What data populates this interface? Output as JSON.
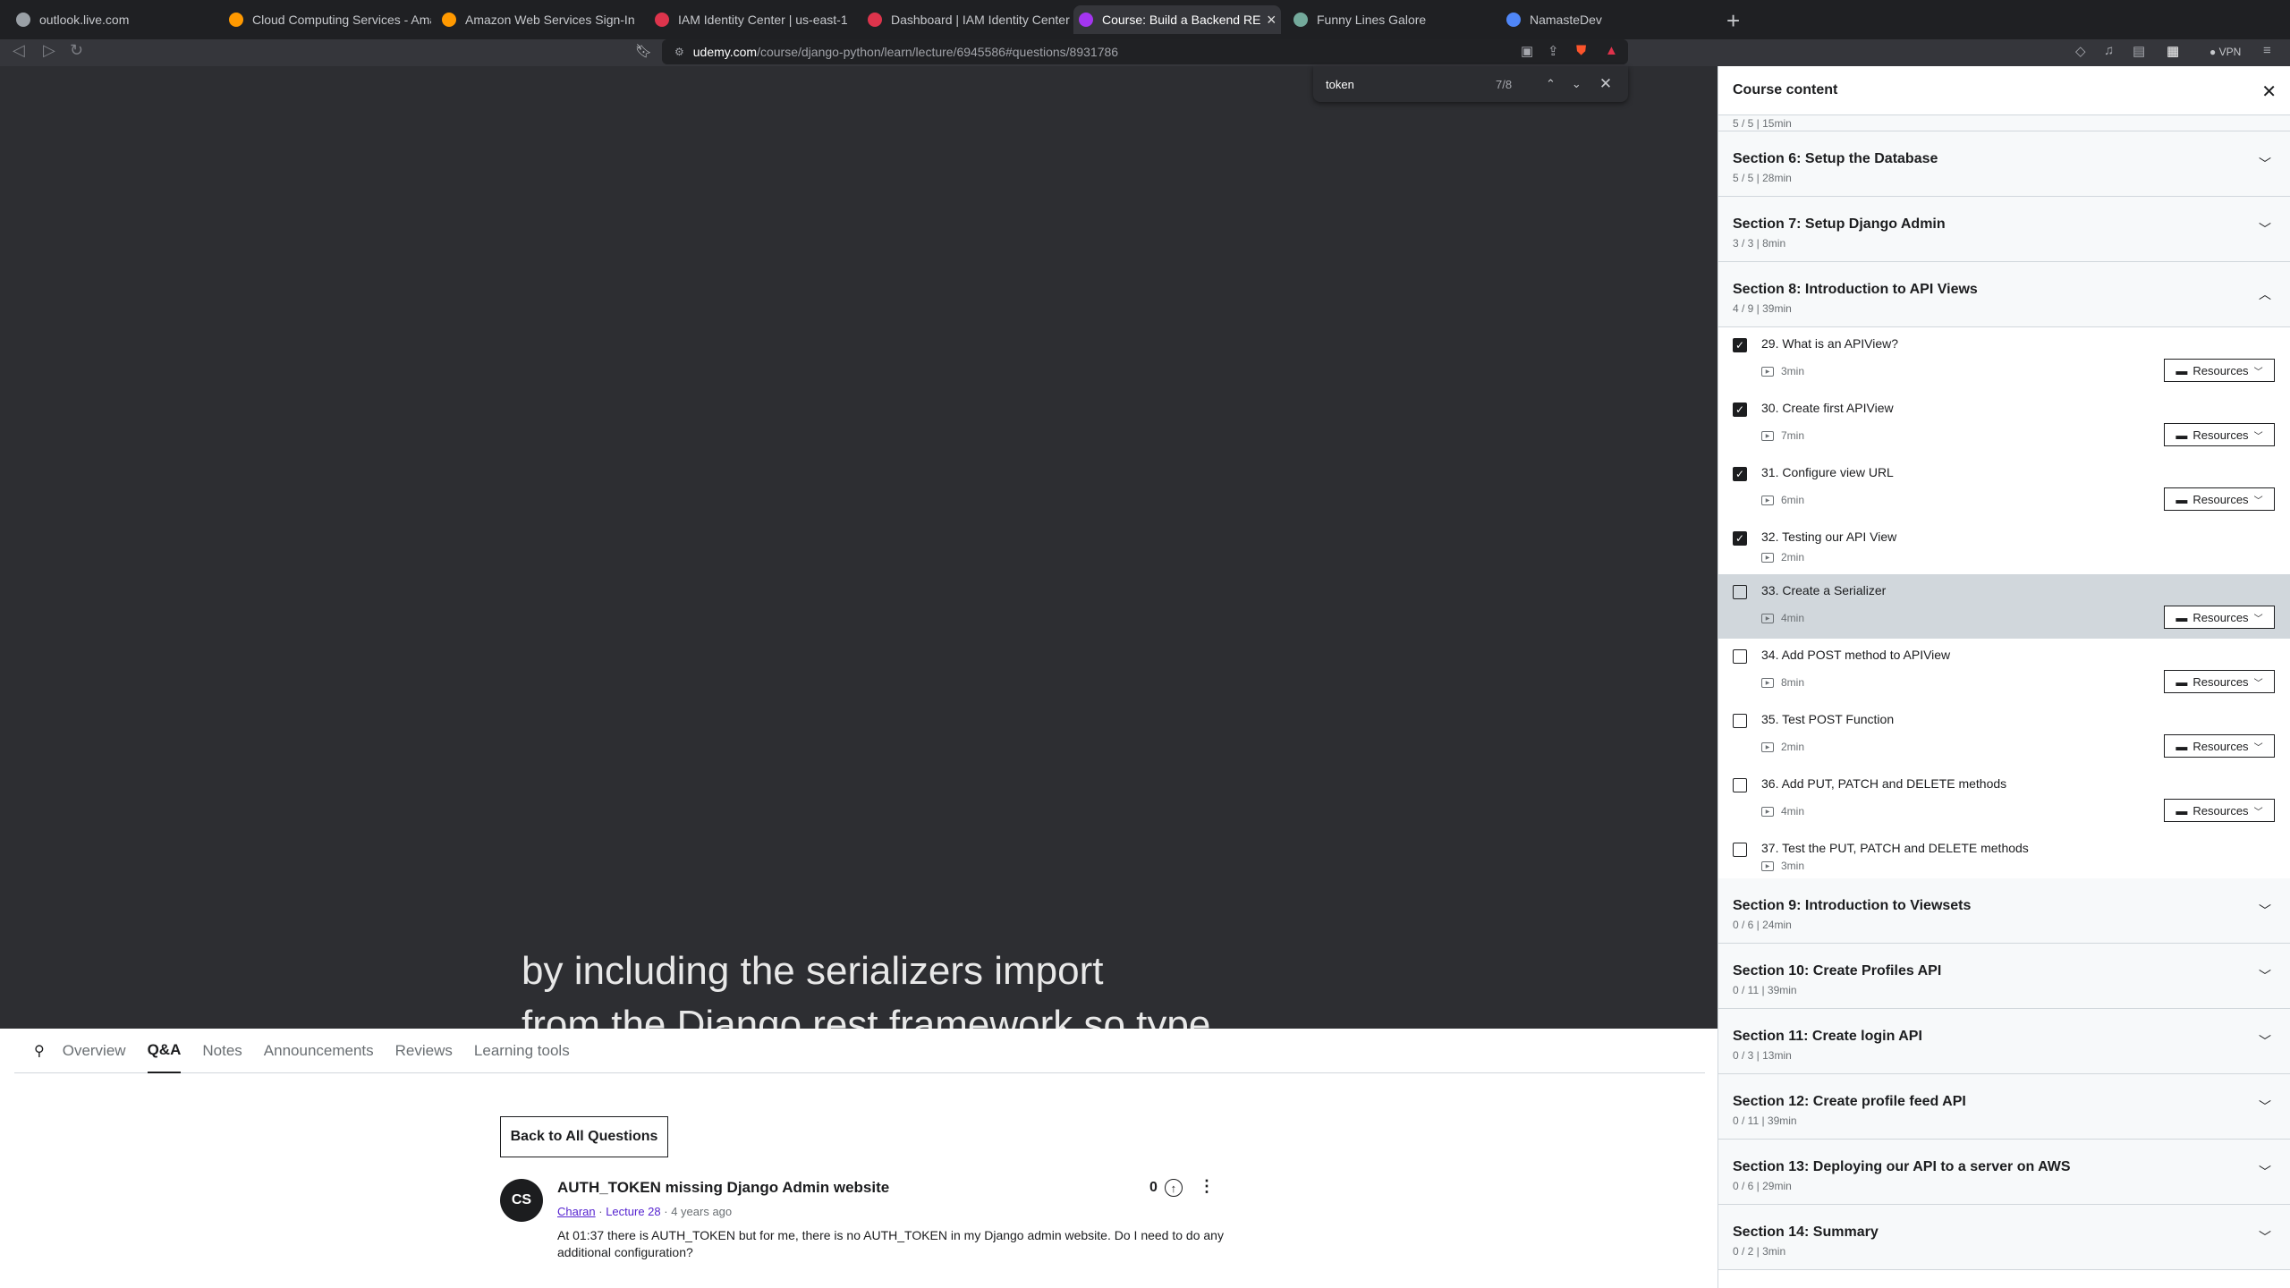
{
  "browser": {
    "tabs": [
      {
        "label": "outlook.live.com",
        "color": "#9aa0a6"
      },
      {
        "label": "Cloud Computing Services - Amazon",
        "color": "#ff9900"
      },
      {
        "label": "Amazon Web Services Sign-In",
        "color": "#ff9900"
      },
      {
        "label": "IAM Identity Center | us-east-1",
        "color": "#dd344c"
      },
      {
        "label": "Dashboard | IAM Identity Center | us",
        "color": "#dd344c"
      },
      {
        "label": "Course: Build a Backend REST",
        "color": "#a435f0"
      },
      {
        "label": "Funny Lines Galore",
        "color": "#74aa9c"
      },
      {
        "label": "NamasteDev",
        "color": "#4f86f7"
      }
    ],
    "active_tab_close": "×",
    "new_tab": "+",
    "url_domain": "udemy.com",
    "url_path": "/course/django-python/learn/lecture/6945586#questions/8931786",
    "vpn_label": "VPN",
    "find": {
      "query": "token",
      "count": "7/8"
    }
  },
  "video": {
    "caption_line1": "by including the serializers import",
    "caption_line2": "from the Django rest framework so type"
  },
  "content_tabs": [
    "Overview",
    "Q&A",
    "Notes",
    "Announcements",
    "Reviews",
    "Learning tools"
  ],
  "active_content_tab": "Q&A",
  "question": {
    "back_label": "Back to All Questions",
    "avatar_initials": "CS",
    "title": "AUTH_TOKEN missing Django Admin website",
    "author": "Charan",
    "lecture": "Lecture 28",
    "time": "4 years ago",
    "separator": " · ",
    "body": "At 01:37 there is AUTH_TOKEN but for me, there is no AUTH_TOKEN in my Django admin website. Do I need to do any additional configuration?",
    "votes": "0"
  },
  "sidebar": {
    "title": "Course content",
    "prev_section_sub": "5 / 5 | 15min",
    "sections_before": [
      {
        "title": "Section 6: Setup the Database",
        "sub": "5 / 5 | 28min"
      },
      {
        "title": "Section 7: Setup Django Admin",
        "sub": "3 / 3 | 8min"
      }
    ],
    "open_section": {
      "title": "Section 8: Introduction to API Views",
      "sub": "4 / 9 | 39min"
    },
    "lectures": [
      {
        "title": "29. What is an APIView?",
        "duration": "3min",
        "done": true,
        "resources": true
      },
      {
        "title": "30. Create first APIView",
        "duration": "7min",
        "done": true,
        "resources": true
      },
      {
        "title": "31. Configure view URL",
        "duration": "6min",
        "done": true,
        "resources": true
      },
      {
        "title": "32. Testing our API View",
        "duration": "2min",
        "done": true,
        "resources": false
      },
      {
        "title": "33. Create a Serializer",
        "duration": "4min",
        "done": false,
        "resources": true,
        "current": true
      },
      {
        "title": "34. Add POST method to APIView",
        "duration": "8min",
        "done": false,
        "resources": true
      },
      {
        "title": "35. Test POST Function",
        "duration": "2min",
        "done": false,
        "resources": true
      },
      {
        "title": "36. Add PUT, PATCH and DELETE methods",
        "duration": "4min",
        "done": false,
        "resources": true
      },
      {
        "title": "37. Test the PUT, PATCH and DELETE methods",
        "duration": "3min",
        "done": false,
        "resources": false
      }
    ],
    "resources_label": "Resources",
    "sections_after": [
      {
        "title": "Section 9: Introduction to Viewsets",
        "sub": "0 / 6 | 24min"
      },
      {
        "title": "Section 10: Create Profiles API",
        "sub": "0 / 11 | 39min"
      },
      {
        "title": "Section 11: Create login API",
        "sub": "0 / 3 | 13min"
      },
      {
        "title": "Section 12: Create profile feed API",
        "sub": "0 / 11 | 39min"
      },
      {
        "title": "Section 13: Deploying our API to a server on AWS",
        "sub": "0 / 6 | 29min"
      },
      {
        "title": "Section 14: Summary",
        "sub": "0 / 2 | 3min"
      }
    ]
  }
}
